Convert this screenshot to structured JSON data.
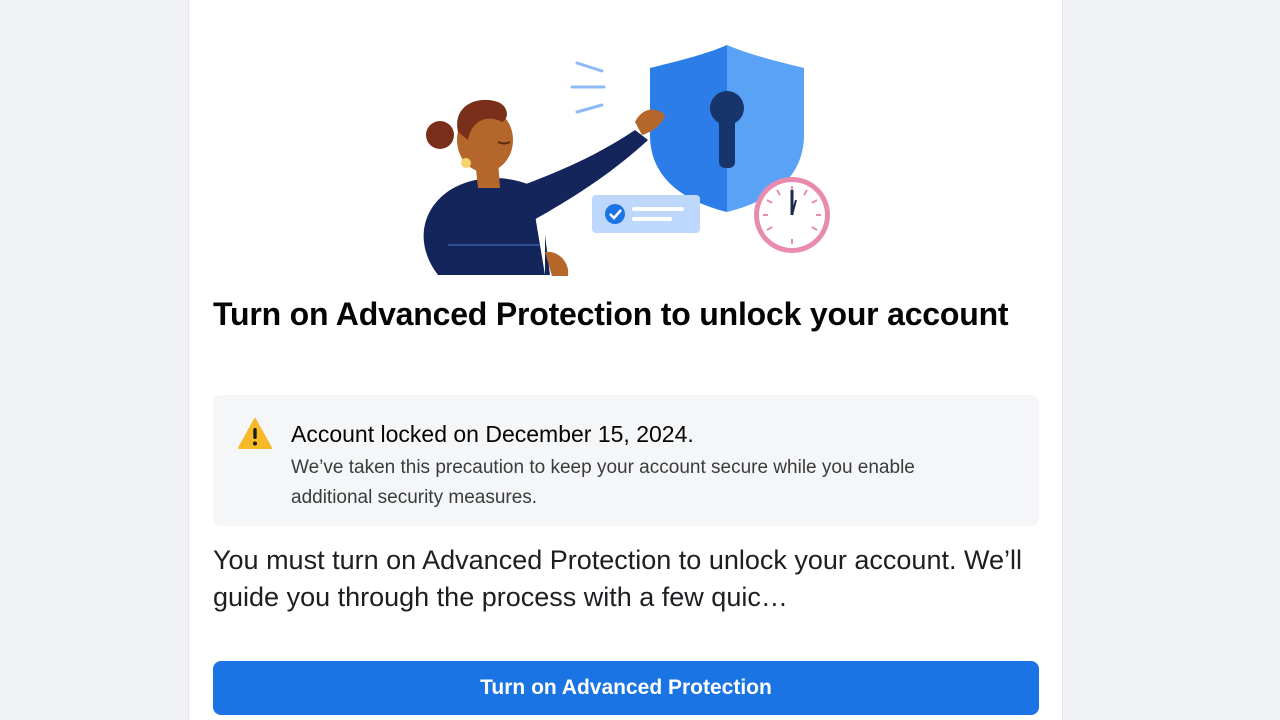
{
  "page": {
    "title": "Turn on Advanced Protection to unlock your account"
  },
  "notice": {
    "icon": "warning-triangle-icon",
    "heading": "Account locked on December 15, 2024.",
    "body": "We’ve taken this precaution to keep your account secure while you enable additional security measures."
  },
  "description": "You must turn on Advanced Protection to unlock your account. We’ll guide you through the process with a few quic…",
  "primary_button": {
    "label": "Turn on Advanced Protection"
  },
  "illustration": {
    "icon": "person-securing-shield-illustration"
  },
  "colors": {
    "primary": "#1b74e4",
    "warning": "#f7b928",
    "background": "#f0f2f5",
    "card": "#ffffff"
  }
}
